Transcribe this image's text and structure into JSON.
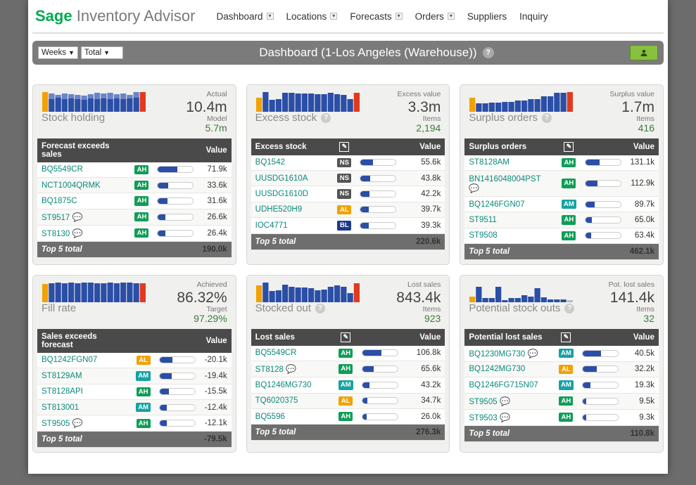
{
  "logo": {
    "sage": "Sage",
    "rest": "Inventory Advisor"
  },
  "nav": [
    "Dashboard",
    "Locations",
    "Forecasts",
    "Orders",
    "Suppliers",
    "Inquiry"
  ],
  "nav_has_caret": [
    true,
    true,
    true,
    true,
    false,
    false
  ],
  "toolbar": {
    "sel1": "Weeks",
    "sel2": "Total",
    "title": "Dashboard (1-Los Angeles (Warehouse))"
  },
  "cards": [
    {
      "title": "Stock holding",
      "help": false,
      "metric": {
        "lbl1": "Actual",
        "big": "10.4m",
        "lbl2": "Model",
        "med": "5.7m"
      },
      "chart": {
        "first_color": "#f2a100",
        "last_color": "#e13a1f",
        "bar_color": "#2b4ea6",
        "heights": [
          28,
          26,
          24,
          26,
          25,
          24,
          23,
          25,
          27,
          26,
          27,
          25,
          26,
          24,
          28,
          28
        ],
        "secondary": [
          0,
          18,
          20,
          18,
          19,
          18,
          17,
          19,
          18,
          19,
          18,
          19,
          18,
          19,
          20,
          0
        ],
        "secondary_color": "#6b84c7"
      },
      "table": {
        "header": "Forecast exceeds sales",
        "value_label": "Value",
        "edit": false,
        "rows": [
          {
            "code": "BQ5549CR",
            "chat": false,
            "badge": "AH",
            "bar": 55,
            "val": "71.9k"
          },
          {
            "code": "NCT1004QRMK",
            "chat": false,
            "badge": "AH",
            "bar": 30,
            "val": "33.6k"
          },
          {
            "code": "BQ1875C",
            "chat": false,
            "badge": "AH",
            "bar": 28,
            "val": "31.6k"
          },
          {
            "code": "ST9517",
            "chat": true,
            "badge": "AH",
            "bar": 22,
            "val": "26.6k"
          },
          {
            "code": "ST8130",
            "chat": true,
            "badge": "AH",
            "bar": 22,
            "val": "26.4k"
          }
        ],
        "footer_label": "Top 5 total",
        "footer_val": "190.0k"
      }
    },
    {
      "title": "Excess stock",
      "help": true,
      "metric": {
        "lbl1": "Excess value",
        "big": "3.3m",
        "lbl2": "Items",
        "med": "2,194"
      },
      "chart": {
        "first_color": "#f2a100",
        "last_color": "#e13a1f",
        "bar_color": "#2b4ea6",
        "heights": [
          20,
          28,
          17,
          18,
          27,
          27,
          26,
          26,
          26,
          25,
          25,
          27,
          25,
          24,
          18,
          27
        ]
      },
      "table": {
        "header": "Excess stock",
        "value_label": "Value",
        "edit": true,
        "rows": [
          {
            "code": "BQ1542",
            "chat": false,
            "badge": "NS",
            "bar": 35,
            "val": "55.6k"
          },
          {
            "code": "UUSDG1610A",
            "chat": false,
            "badge": "NS",
            "bar": 28,
            "val": "43.8k"
          },
          {
            "code": "UUSDG1610D",
            "chat": false,
            "badge": "NS",
            "bar": 26,
            "val": "42.2k"
          },
          {
            "code": "UDHE520H9",
            "chat": false,
            "badge": "AL",
            "bar": 24,
            "val": "39.7k"
          },
          {
            "code": "IOC4771",
            "chat": false,
            "badge": "BL",
            "bar": 23,
            "val": "39.3k"
          }
        ],
        "footer_label": "Top 5 total",
        "footer_val": "220.6k"
      }
    },
    {
      "title": "Surplus orders",
      "help": true,
      "metric": {
        "lbl1": "Surplus value",
        "big": "1.7m",
        "lbl2": "Items",
        "med": "416"
      },
      "chart": {
        "first_color": "#f2a100",
        "last_color": "#e13a1f",
        "bar_color": "#2b4ea6",
        "heights": [
          20,
          12,
          12,
          13,
          13,
          14,
          14,
          16,
          16,
          18,
          18,
          22,
          22,
          27,
          27,
          28
        ]
      },
      "table": {
        "header": "Surplus orders",
        "value_label": "Value",
        "edit": true,
        "rows": [
          {
            "code": "ST8128AM",
            "chat": false,
            "badge": "AH",
            "bar": 40,
            "val": "131.1k"
          },
          {
            "code": "BN1416048004PST",
            "chat": true,
            "badge": "AH",
            "bar": 34,
            "val": "112.9k"
          },
          {
            "code": "BQ1246FGN07",
            "chat": false,
            "badge": "AM",
            "bar": 26,
            "val": "89.7k"
          },
          {
            "code": "ST9511",
            "chat": false,
            "badge": "AH",
            "bar": 18,
            "val": "65.0k"
          },
          {
            "code": "ST9508",
            "chat": false,
            "badge": "AH",
            "bar": 17,
            "val": "63.4k"
          }
        ],
        "footer_label": "Top 5 total",
        "footer_val": "462.1k"
      }
    },
    {
      "title": "Fill rate",
      "help": false,
      "metric": {
        "lbl1": "Achieved",
        "big": "86.32%",
        "lbl2": "Target",
        "med": "97.29%"
      },
      "chart": {
        "first_color": "#f2a100",
        "last_color": "#e13a1f",
        "bar_color": "#2b4ea6",
        "heights": [
          26,
          27,
          28,
          27,
          28,
          27,
          28,
          28,
          27,
          27,
          28,
          27,
          28,
          28,
          27,
          27
        ]
      },
      "table": {
        "header": "Sales exceeds forecast",
        "value_label": "Value",
        "edit": false,
        "rows": [
          {
            "code": "BQ1242FGN07",
            "chat": false,
            "badge": "AL",
            "bar": 36,
            "val": "-20.1k"
          },
          {
            "code": "ST8129AM",
            "chat": false,
            "badge": "AM",
            "bar": 34,
            "val": "-19.4k"
          },
          {
            "code": "ST8128API",
            "chat": false,
            "badge": "AH",
            "bar": 26,
            "val": "-15.5k"
          },
          {
            "code": "ST813001",
            "chat": false,
            "badge": "AM",
            "bar": 20,
            "val": "-12.4k"
          },
          {
            "code": "ST9505",
            "chat": true,
            "badge": "AH",
            "bar": 20,
            "val": "-12.1k"
          }
        ],
        "footer_label": "Top 5 total",
        "footer_val": "-79.5k"
      }
    },
    {
      "title": "Stocked out",
      "help": true,
      "metric": {
        "lbl1": "Lost sales",
        "big": "843.4k",
        "lbl2": "Items",
        "med": "923"
      },
      "chart": {
        "first_color": "#f2a100",
        "last_color": "#e13a1f",
        "bar_color": "#2b4ea6",
        "heights": [
          24,
          28,
          16,
          17,
          25,
          22,
          21,
          21,
          20,
          17,
          18,
          22,
          24,
          22,
          13,
          27
        ]
      },
      "table": {
        "header": "Lost sales",
        "value_label": "Value",
        "edit": true,
        "rows": [
          {
            "code": "BQ5549CR",
            "chat": false,
            "badge": "AH",
            "bar": 55,
            "val": "106.8k"
          },
          {
            "code": "ST8128",
            "chat": true,
            "badge": "AH",
            "bar": 32,
            "val": "65.6k"
          },
          {
            "code": "BQ1246MG730",
            "chat": false,
            "badge": "AM",
            "bar": 20,
            "val": "43.2k"
          },
          {
            "code": "TQ6020375",
            "chat": false,
            "badge": "AL",
            "bar": 15,
            "val": "34.7k"
          },
          {
            "code": "BQ5596",
            "chat": false,
            "badge": "AH",
            "bar": 12,
            "val": "26.0k"
          }
        ],
        "footer_label": "Top 5 total",
        "footer_val": "276.3k"
      }
    },
    {
      "title": "Potential stock outs",
      "help": true,
      "metric": {
        "lbl1": "Pot. lost sales",
        "big": "141.4k",
        "lbl2": "Items",
        "med": "32"
      },
      "chart": {
        "first_color": "#f2a100",
        "last_color": "#e13a1f",
        "bar_color": "#2b4ea6",
        "heights": [
          8,
          22,
          6,
          6,
          22,
          3,
          6,
          6,
          10,
          8,
          20,
          7,
          4,
          4,
          4,
          3
        ],
        "gray_last": true
      },
      "table": {
        "header": "Potential lost sales",
        "value_label": "Value",
        "edit": true,
        "rows": [
          {
            "code": "BQ1230MG730",
            "chat": true,
            "badge": "AM",
            "bar": 52,
            "val": "40.5k"
          },
          {
            "code": "BQ1242MG730",
            "chat": false,
            "badge": "AL",
            "bar": 40,
            "val": "32.2k"
          },
          {
            "code": "BQ1246FG715N07",
            "chat": false,
            "badge": "AM",
            "bar": 22,
            "val": "19.3k"
          },
          {
            "code": "ST9505",
            "chat": true,
            "badge": "AH",
            "bar": 10,
            "val": "9.5k"
          },
          {
            "code": "ST9503",
            "chat": true,
            "badge": "AH",
            "bar": 10,
            "val": "9.3k"
          }
        ],
        "footer_label": "Top 5 total",
        "footer_val": "110.8k"
      }
    }
  ]
}
